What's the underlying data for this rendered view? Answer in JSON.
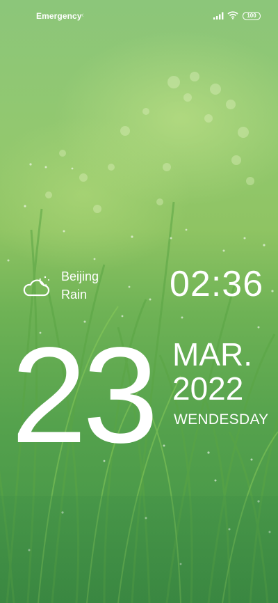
{
  "status_bar": {
    "carrier_text": "Emergency",
    "battery": "100"
  },
  "weather": {
    "icon": "cloudy-moon-icon",
    "city": "Beijing",
    "condition": "Rain"
  },
  "clock": {
    "time": "02:36"
  },
  "date": {
    "day": "23",
    "month": "MAR.",
    "year": "2022",
    "weekday": "WENDESDAY"
  }
}
